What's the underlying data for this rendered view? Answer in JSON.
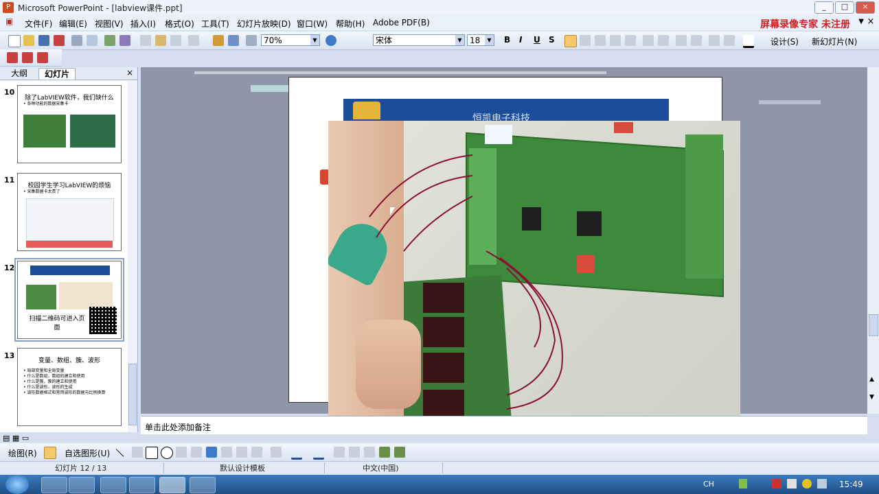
{
  "window": {
    "title": "Microsoft PowerPoint - [labview课件.ppt]",
    "controls": [
      "_",
      "□",
      "×"
    ]
  },
  "menu": {
    "items": [
      "文件(F)",
      "编辑(E)",
      "视图(V)",
      "插入(I)",
      "格式(O)",
      "工具(T)",
      "幻灯片放映(D)",
      "窗口(W)",
      "帮助(H)",
      "Adobe PDF(B)"
    ],
    "watermark": "屏幕录像专家  未注册"
  },
  "toolbar": {
    "zoom": "70%",
    "font": "宋体",
    "font_size": "18",
    "bold": "B",
    "italic": "I",
    "underline": "U",
    "shadow": "S",
    "design_label": "设计(S)",
    "new_slide_label": "新幻灯片(N)"
  },
  "left_pane": {
    "tab_outline": "大纲",
    "tab_slides": "幻灯片",
    "close": "×",
    "slides": [
      {
        "number": "10",
        "title": "除了LabVIEW软件，我们缺什么",
        "bullets": [
          "• 各种功能的数据采集卡"
        ]
      },
      {
        "number": "11",
        "title": "校园学生学习LabVIEW的烦恼",
        "bullets": [
          "• 采集数据卡太贵了"
        ]
      },
      {
        "number": "12",
        "title": "扫描二维码可进入页面",
        "bullets": []
      },
      {
        "number": "13",
        "title": "变量、数组、簇、波形",
        "bullets": [
          "• 局部变量和全局变量",
          "• 什么是数组，数组的建立和使用",
          "• 什么是簇，簇的建立和使用",
          "• 什么是波形，波形的生成",
          "• 波形数据格式和常用波形的数据与比例换算"
        ]
      }
    ]
  },
  "slide": {
    "banner_text": "恒凯电子科技"
  },
  "notes": {
    "placeholder": "单击此处添加备注"
  },
  "drawing_toolbar": {
    "draw_label": "绘图(R)",
    "autoshapes_label": "自选图形(U)"
  },
  "status_bar": {
    "slide_position": "幻灯片 12 / 13",
    "template": "默认设计模板",
    "language": "中文(中国)"
  },
  "taskbar": {
    "lang": "CH",
    "time": "15:49"
  },
  "colors": {
    "watermark": "#d42020",
    "banner": "#1c4d9a",
    "title_bar": "#eef2fa"
  }
}
